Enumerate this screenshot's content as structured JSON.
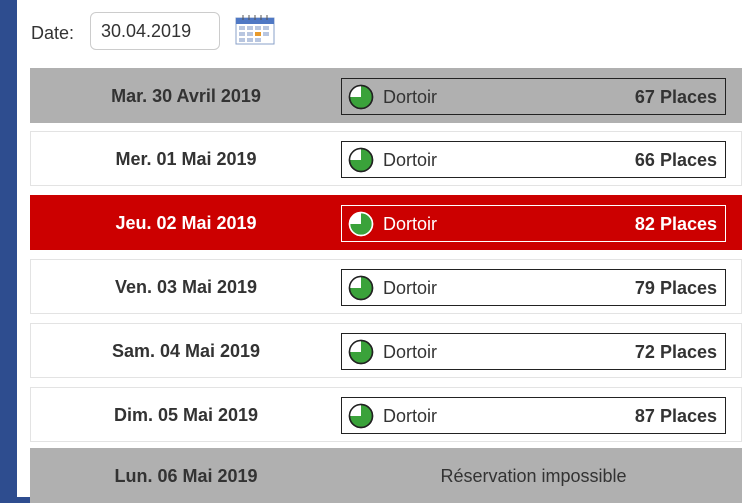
{
  "date_picker": {
    "label": "Date:",
    "value": "30.04.2019",
    "icon": "calendar-icon"
  },
  "colors": {
    "background": "#2e4d8f",
    "gray_row": "#b0b0b0",
    "selected_row": "#cc0000",
    "pie_fill": "#3aa23a"
  },
  "rows": [
    {
      "date": "Mar. 30 Avril 2019",
      "room": "Dortoir",
      "places": "67 Places",
      "state": "gray"
    },
    {
      "date": "Mer. 01 Mai 2019",
      "room": "Dortoir",
      "places": "66 Places",
      "state": "normal"
    },
    {
      "date": "Jeu. 02 Mai 2019",
      "room": "Dortoir",
      "places": "82 Places",
      "state": "selected"
    },
    {
      "date": "Ven. 03 Mai 2019",
      "room": "Dortoir",
      "places": "79 Places",
      "state": "normal"
    },
    {
      "date": "Sam. 04 Mai 2019",
      "room": "Dortoir",
      "places": "72 Places",
      "state": "normal"
    },
    {
      "date": "Dim. 05 Mai 2019",
      "room": "Dortoir",
      "places": "87 Places",
      "state": "normal"
    },
    {
      "date": "Lun. 06 Mai 2019",
      "message": "Réservation impossible",
      "state": "gray"
    }
  ]
}
